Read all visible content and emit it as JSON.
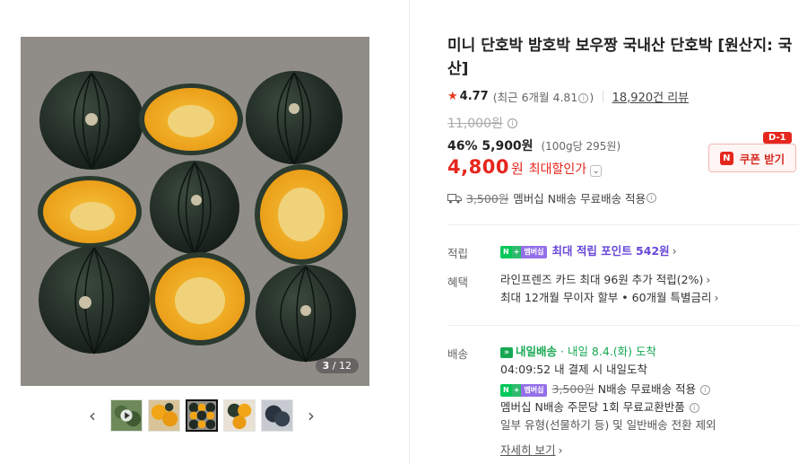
{
  "gallery": {
    "counter_current": "3",
    "counter_total": "/ 12",
    "thumbnails": [
      {
        "name": "thumbnail-video"
      },
      {
        "name": "thumbnail-2"
      },
      {
        "name": "thumbnail-3",
        "active": true
      },
      {
        "name": "thumbnail-4"
      },
      {
        "name": "thumbnail-5"
      }
    ],
    "prev_icon": "‹",
    "next_icon": "›"
  },
  "product": {
    "title": "미니 단호박 밤호박 보우짱 국내산 단호박 [원산지: 국산]",
    "rating": {
      "star": "★",
      "score": "4.77",
      "recent_prefix": "(최근 6개월 4.81",
      "recent_suffix": ")",
      "reviews": "18,920건 리뷰"
    },
    "original_price": "11,000원",
    "discount": "46%",
    "sale_price": "5,900원",
    "unit_price": "(100g당 295원)",
    "max_discount_price": "4,800",
    "max_discount_won": "원",
    "max_discount_label": "최대할인가",
    "coupon": {
      "badge": "D-1",
      "label": "쿠폰 받기",
      "logo": "N"
    },
    "shipping": {
      "orig_fee": "3,500원",
      "text": "멤버십 N배송 무료배송 적용"
    }
  },
  "benefits": {
    "points_label": "적립",
    "points_text": "최대 적립 포인트 542원",
    "benefit_label": "혜택",
    "card_text": "라인프렌즈 카드 최대 96원 추가 적립(2%)",
    "installment_text": "최대 12개월 무이자 할부 • 60개월 특별금리"
  },
  "delivery": {
    "label": "배송",
    "badge_text": "내일배송",
    "eta": "· 내일 8.4.(화) 도착",
    "countdown": "04:09:52",
    "countdown_text": "내 결제 시 내일도착",
    "member_orig_fee": "3,500원",
    "member_text": "N배송 무료배송 적용",
    "exchange_text": "멤버십 N배송 주문당 1회 무료교환반품",
    "exclusion_text": "일부 유형(선물하기 등) 및 일반배송 전환 제외",
    "detail_link": "자세히 보기"
  },
  "badges": {
    "n": "N",
    "plus": "+",
    "membership": "멤버십"
  },
  "colors": {
    "accent_red": "#e5261d",
    "points_purple": "#6848d8",
    "delivery_green": "#17a853",
    "pumpkin_skin": "#1f2a22",
    "pumpkin_flesh": "#f2a516"
  }
}
